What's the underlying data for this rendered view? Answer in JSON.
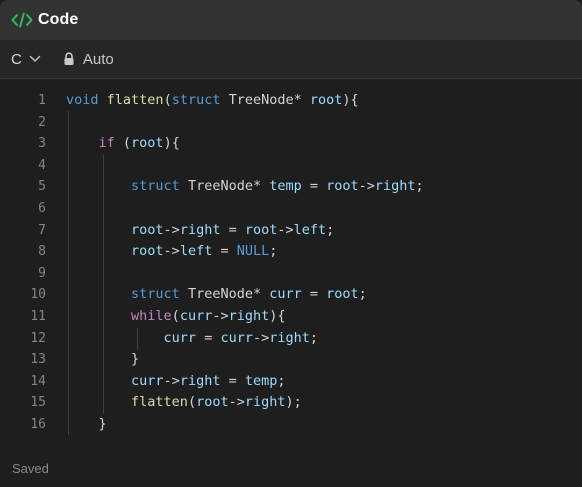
{
  "header": {
    "title": "Code",
    "icon": "code-brackets-icon",
    "icon_color": "#2cbb5d"
  },
  "toolbar": {
    "language": "C",
    "lock_icon": "lock-icon",
    "mode_label": "Auto"
  },
  "editor": {
    "line_numbers": [
      "1",
      "2",
      "3",
      "4",
      "5",
      "6",
      "7",
      "8",
      "9",
      "10",
      "11",
      "12",
      "13",
      "14",
      "15",
      "16"
    ],
    "lines": [
      [
        {
          "t": "void",
          "c": "kw"
        },
        {
          "t": " "
        },
        {
          "t": "flatten",
          "c": "fn"
        },
        {
          "t": "("
        },
        {
          "t": "struct",
          "c": "kw"
        },
        {
          "t": " TreeNode* "
        },
        {
          "t": "root",
          "c": "var"
        },
        {
          "t": "){"
        }
      ],
      [],
      [
        {
          "t": "    "
        },
        {
          "t": "if",
          "c": "ctl"
        },
        {
          "t": " ("
        },
        {
          "t": "root",
          "c": "var"
        },
        {
          "t": "){"
        }
      ],
      [],
      [
        {
          "t": "        "
        },
        {
          "t": "struct",
          "c": "kw"
        },
        {
          "t": " TreeNode* "
        },
        {
          "t": "temp",
          "c": "var"
        },
        {
          "t": " = "
        },
        {
          "t": "root",
          "c": "var"
        },
        {
          "t": "->"
        },
        {
          "t": "right",
          "c": "var"
        },
        {
          "t": ";"
        }
      ],
      [],
      [
        {
          "t": "        "
        },
        {
          "t": "root",
          "c": "var"
        },
        {
          "t": "->"
        },
        {
          "t": "right",
          "c": "var"
        },
        {
          "t": " = "
        },
        {
          "t": "root",
          "c": "var"
        },
        {
          "t": "->"
        },
        {
          "t": "left",
          "c": "var"
        },
        {
          "t": ";"
        }
      ],
      [
        {
          "t": "        "
        },
        {
          "t": "root",
          "c": "var"
        },
        {
          "t": "->"
        },
        {
          "t": "left",
          "c": "var"
        },
        {
          "t": " = "
        },
        {
          "t": "NULL",
          "c": "kw"
        },
        {
          "t": ";"
        }
      ],
      [],
      [
        {
          "t": "        "
        },
        {
          "t": "struct",
          "c": "kw"
        },
        {
          "t": " TreeNode* "
        },
        {
          "t": "curr",
          "c": "var"
        },
        {
          "t": " = "
        },
        {
          "t": "root",
          "c": "var"
        },
        {
          "t": ";"
        }
      ],
      [
        {
          "t": "        "
        },
        {
          "t": "while",
          "c": "ctl"
        },
        {
          "t": "("
        },
        {
          "t": "curr",
          "c": "var"
        },
        {
          "t": "->"
        },
        {
          "t": "right",
          "c": "var"
        },
        {
          "t": "){"
        }
      ],
      [
        {
          "t": "            "
        },
        {
          "t": "curr",
          "c": "var"
        },
        {
          "t": " = "
        },
        {
          "t": "curr",
          "c": "var"
        },
        {
          "t": "->"
        },
        {
          "t": "right",
          "c": "var"
        },
        {
          "t": ";"
        }
      ],
      [
        {
          "t": "        }"
        }
      ],
      [
        {
          "t": "        "
        },
        {
          "t": "curr",
          "c": "var"
        },
        {
          "t": "->"
        },
        {
          "t": "right",
          "c": "var"
        },
        {
          "t": " = "
        },
        {
          "t": "temp",
          "c": "var"
        },
        {
          "t": ";"
        }
      ],
      [
        {
          "t": "        "
        },
        {
          "t": "flatten",
          "c": "fn"
        },
        {
          "t": "("
        },
        {
          "t": "root",
          "c": "var"
        },
        {
          "t": "->"
        },
        {
          "t": "right",
          "c": "var"
        },
        {
          "t": ");"
        }
      ],
      [
        {
          "t": "    }"
        }
      ]
    ]
  },
  "footer": {
    "status": "Saved"
  }
}
